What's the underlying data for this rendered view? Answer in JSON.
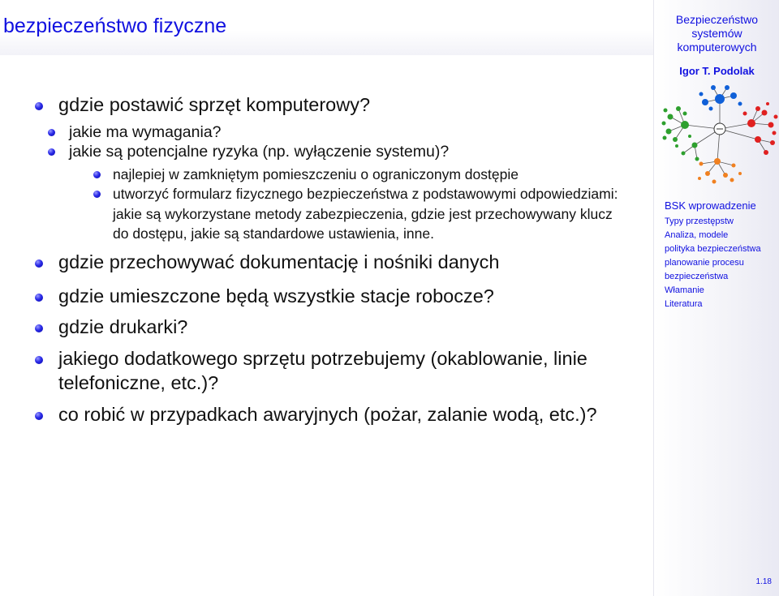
{
  "slide": {
    "title": "bezpieczeństwo fizyczne",
    "page_number": "1.18"
  },
  "sidebar": {
    "title_lines": [
      "Bezpieczeństwo",
      "systemów",
      "komputerowych"
    ],
    "author": "Igor T. Podolak",
    "nav": [
      {
        "label": "BSK wprowadzenie"
      },
      {
        "label": "Typy przestępstw"
      },
      {
        "label": "Analiza, modele"
      },
      {
        "label": "polityka bezpieczeństwa"
      },
      {
        "label_lines": [
          "planowanie procesu",
          "bezpieczeństwa"
        ]
      },
      {
        "label": "Włamanie"
      },
      {
        "label": "Literatura"
      }
    ]
  },
  "content": {
    "item1": "gdzie postawić sprzęt komputerowy?",
    "item1_sub1": "jakie ma wymagania?",
    "item1_sub2": "jakie są potencjalne ryzyka (np. wyłączenie systemu)?",
    "item1_sub2_sub1": "najlepiej w zamkniętym pomieszczeniu o ograniczonym dostępie",
    "item1_sub2_sub2": "utworzyć formularz fizycznego bezpieczeństwa z podstawowymi odpowiedziami: jakie są wykorzystane metody zabezpieczenia, gdzie jest przechowywany klucz do dostępu, jakie są standardowe ustawienia, inne.",
    "item2": "gdzie przechowywać dokumentację i nośniki danych",
    "item3": "gdzie umieszczone będą wszystkie stacje robocze?",
    "item4": "gdzie drukarki?",
    "item5": "jakiego dodatkowego sprzętu potrzebujemy (okablowanie, linie telefoniczne, etc.)?",
    "item6": "co robić w przypadkach awaryjnych (pożar, zalanie wodą, etc.)?"
  },
  "colors": {
    "accent": "#1010e0",
    "logo_green": "#2ea02e",
    "logo_blue": "#1060d8",
    "logo_red": "#e02020",
    "logo_orange": "#f08020"
  },
  "icons": {
    "bullet": "blue-ball-bullet",
    "logo": "network-tree-logo"
  }
}
